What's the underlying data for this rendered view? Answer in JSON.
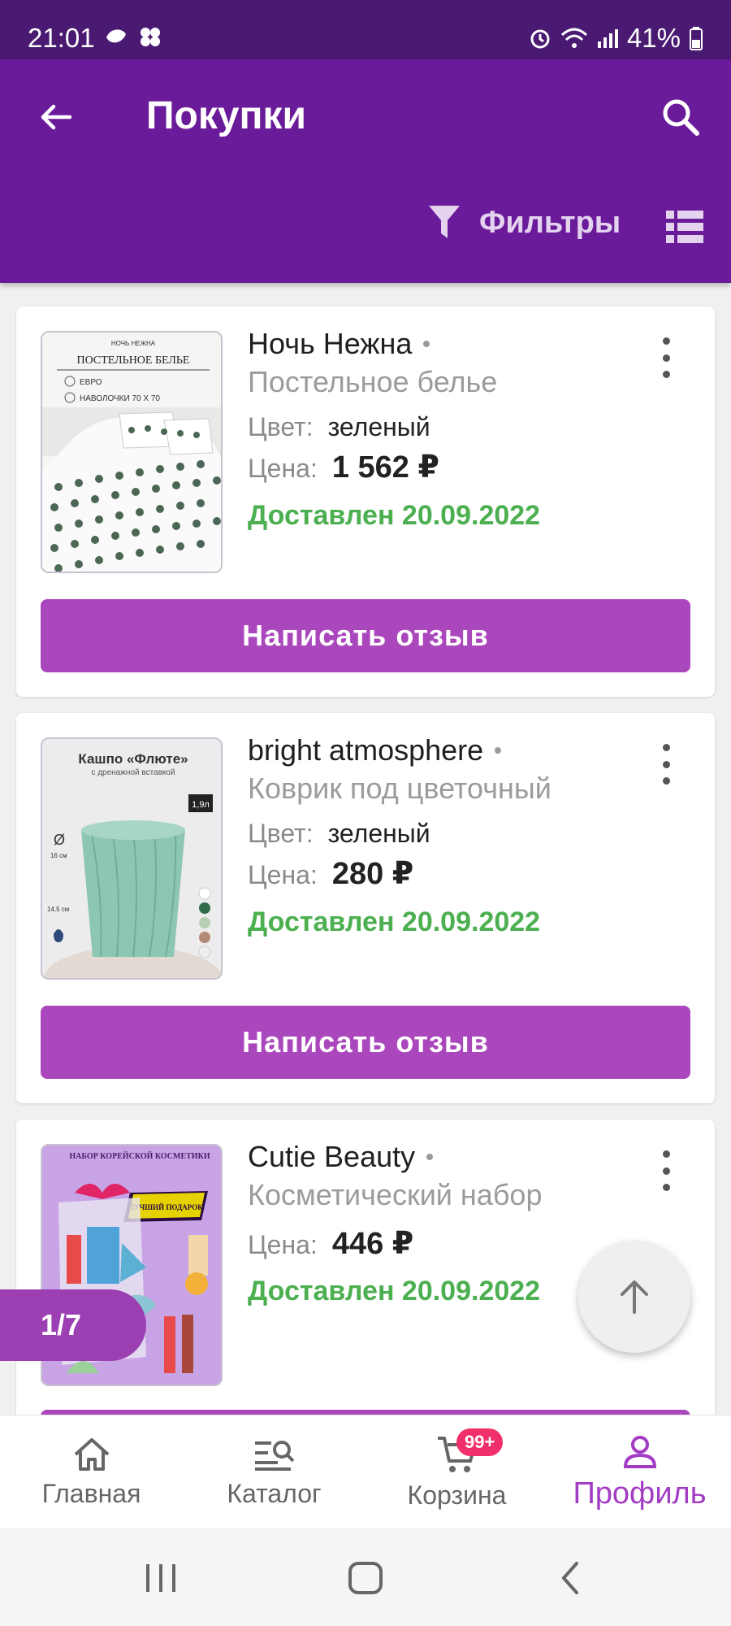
{
  "status": {
    "time": "21:01",
    "battery": "41%"
  },
  "header": {
    "title": "Покупки",
    "filters_label": "Фильтры"
  },
  "labels": {
    "color": "Цвет:",
    "price": "Цена:"
  },
  "orders": [
    {
      "brand": "Ночь Нежна",
      "name": "Постельное белье",
      "color": "зеленый",
      "price": "1 562 ₽",
      "status": "Доставлен 20.09.2022",
      "action": "Написать отзыв",
      "image_text": {
        "top": "НОЧЬ НЕЖНА",
        "title": "ПОСТЕЛЬНОЕ БЕЛЬЕ",
        "line1": "ЕВРО",
        "line2": "НАВОЛОЧКИ 70 Х 70"
      }
    },
    {
      "brand": "bright atmosphere",
      "name": "Коврик под цветочный",
      "color": "зеленый",
      "price": "280 ₽",
      "status": "Доставлен 20.09.2022",
      "action": "Написать отзыв",
      "image_text": {
        "title": "Кашпо «Флюте»",
        "subtitle": "с дренажной вставкой",
        "volume": "1,9л",
        "diam": "16 см",
        "height": "14,5 см"
      }
    },
    {
      "brand": "Cutie Beauty",
      "name": "Косметический набор",
      "price": "446 ₽",
      "status": "Доставлен 20.09.2022",
      "image_text": {
        "title": "НАБОР КОРЕЙСКОЙ КОСМЕТИКИ",
        "ribbon": "ЛУЧШИЙ ПОДАРОК"
      }
    }
  ],
  "pager": {
    "label": "1/7"
  },
  "bottom_nav": {
    "items": [
      {
        "label": "Главная",
        "icon": "home-icon"
      },
      {
        "label": "Каталог",
        "icon": "catalog-icon"
      },
      {
        "label": "Корзина",
        "icon": "cart-icon"
      },
      {
        "label": "Профиль",
        "icon": "profile-icon"
      }
    ],
    "cart_badge": "99+"
  },
  "colors": {
    "app_bar": "#6a1b9a",
    "status_bar": "#4a1a73",
    "accent": "#ab47bc",
    "delivered": "#4caf50",
    "badge": "#f0306a"
  }
}
